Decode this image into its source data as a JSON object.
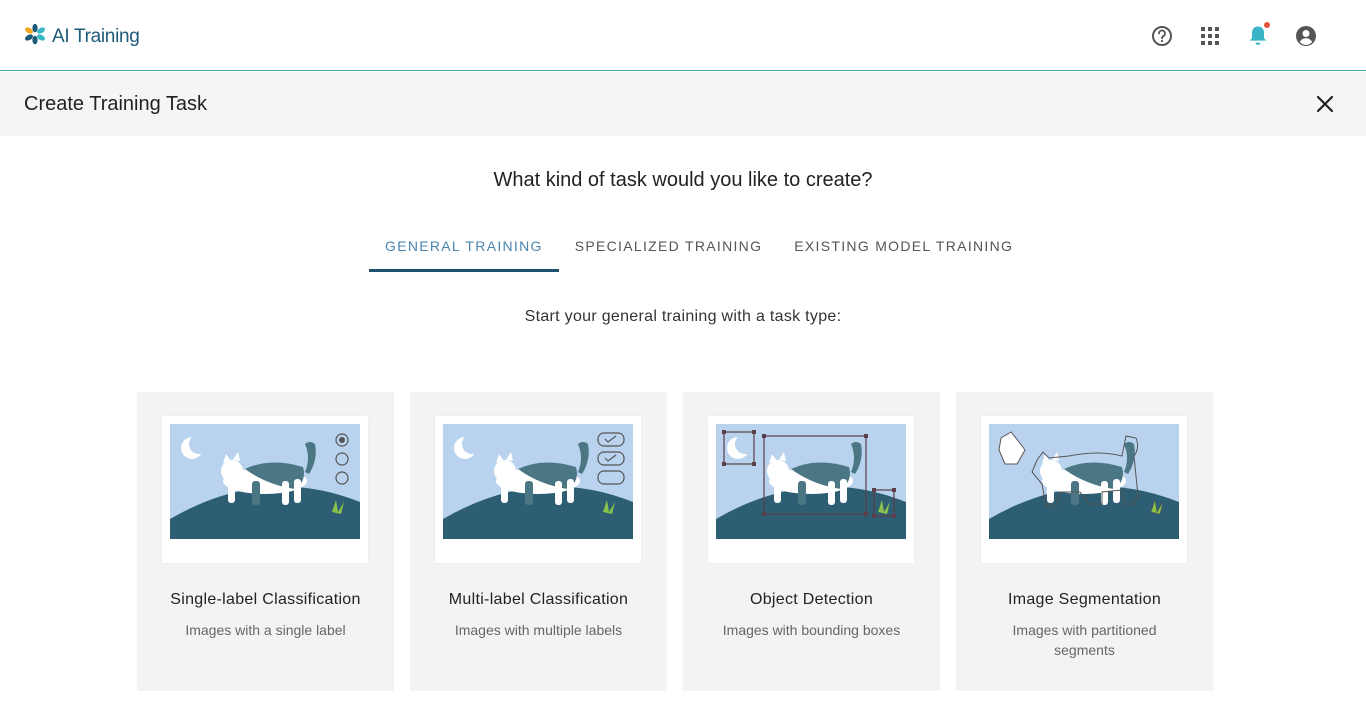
{
  "app": {
    "name": "AI Training"
  },
  "topbar": {
    "icons": [
      "help-icon",
      "apps-grid-icon",
      "bell-icon",
      "account-icon"
    ]
  },
  "titlebar": {
    "title": "Create Training Task"
  },
  "main": {
    "question": "What kind of task would you like to create?",
    "tabs": [
      {
        "label": "GENERAL TRAINING",
        "active": true
      },
      {
        "label": "SPECIALIZED TRAINING",
        "active": false
      },
      {
        "label": "EXISTING MODEL TRAINING",
        "active": false
      }
    ],
    "subtitle": "Start your general training with a task type:",
    "cards": [
      {
        "title": "Single-label Classification",
        "desc": "Images with a single label"
      },
      {
        "title": "Multi-label Classification",
        "desc": "Images with multiple labels"
      },
      {
        "title": "Object Detection",
        "desc": "Images with bounding boxes"
      },
      {
        "title": "Image Segmentation",
        "desc": "Images with partitioned segments"
      }
    ]
  },
  "colors": {
    "accent": "#4a86b0",
    "tab_underline": "#1d4e6c",
    "sky": "#b9d3ee",
    "hill": "#2d5e73",
    "notification_dot": "#e8543a"
  }
}
